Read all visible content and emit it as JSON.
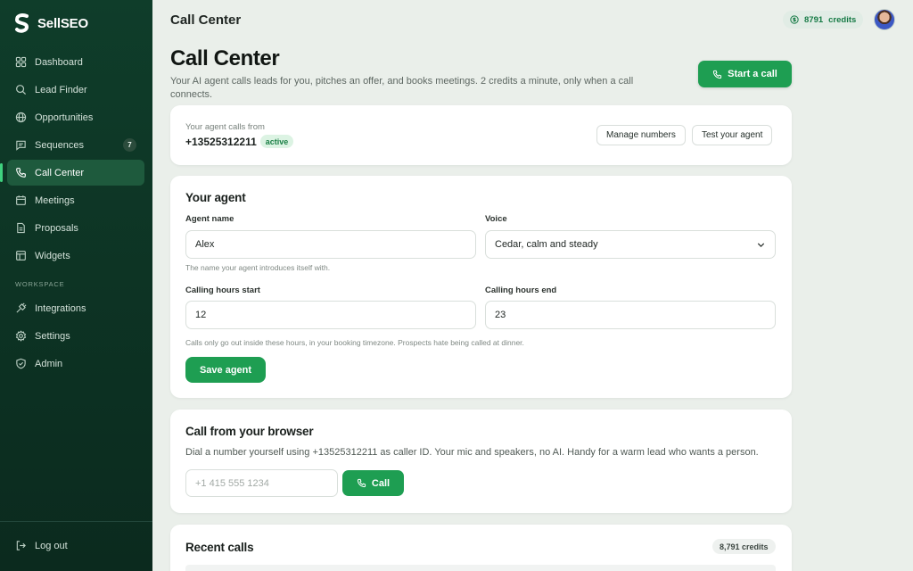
{
  "app": {
    "name": "SellSEO"
  },
  "sidebar": {
    "items": [
      {
        "label": "Dashboard",
        "icon": "grid-icon"
      },
      {
        "label": "Lead Finder",
        "icon": "search-icon"
      },
      {
        "label": "Opportunities",
        "icon": "globe-icon"
      },
      {
        "label": "Sequences",
        "icon": "message-icon",
        "badge": "7"
      },
      {
        "label": "Call Center",
        "icon": "phone-icon",
        "active": true
      },
      {
        "label": "Meetings",
        "icon": "calendar-icon"
      },
      {
        "label": "Proposals",
        "icon": "document-icon"
      },
      {
        "label": "Widgets",
        "icon": "widget-icon"
      }
    ],
    "section_label": "WORKSPACE",
    "workspace_items": [
      {
        "label": "Integrations",
        "icon": "plug-icon"
      },
      {
        "label": "Settings",
        "icon": "gear-icon"
      },
      {
        "label": "Admin",
        "icon": "shield-icon"
      }
    ],
    "logout_label": "Log out"
  },
  "topbar": {
    "title": "Call Center",
    "credits_value": "8791",
    "credits_suffix": "credits"
  },
  "page": {
    "title": "Call Center",
    "subtitle": "Your AI agent calls leads for you, pitches an offer, and books meetings. 2 credits a minute, only when a call connects.",
    "start_call_label": "Start a call"
  },
  "number_card": {
    "label": "Your agent calls from",
    "number": "+13525312211",
    "status": "active",
    "manage_label": "Manage numbers",
    "test_label": "Test your agent"
  },
  "agent": {
    "heading": "Your agent",
    "name_label": "Agent name",
    "name_value": "Alex",
    "name_hint": "The name your agent introduces itself with.",
    "voice_label": "Voice",
    "voice_value": "Cedar, calm and steady",
    "hours_start_label": "Calling hours start",
    "hours_start_value": "12",
    "hours_end_label": "Calling hours end",
    "hours_end_value": "23",
    "hours_hint": "Calls only go out inside these hours, in your booking timezone. Prospects hate being called at dinner.",
    "save_label": "Save agent"
  },
  "browser_call": {
    "heading": "Call from your browser",
    "description": "Dial a number yourself using +13525312211 as caller ID. Your mic and speakers, no AI. Handy for a warm lead who wants a person.",
    "input_placeholder": "+1 415 555 1234",
    "call_label": "Call"
  },
  "recent": {
    "heading": "Recent calls",
    "credits": "8,791 credits"
  },
  "colors": {
    "accent": "#1e9e52",
    "sidebar_bg": "#0f3d2a",
    "sidebar_active": "#1e5a3d",
    "background": "#eaefea"
  }
}
